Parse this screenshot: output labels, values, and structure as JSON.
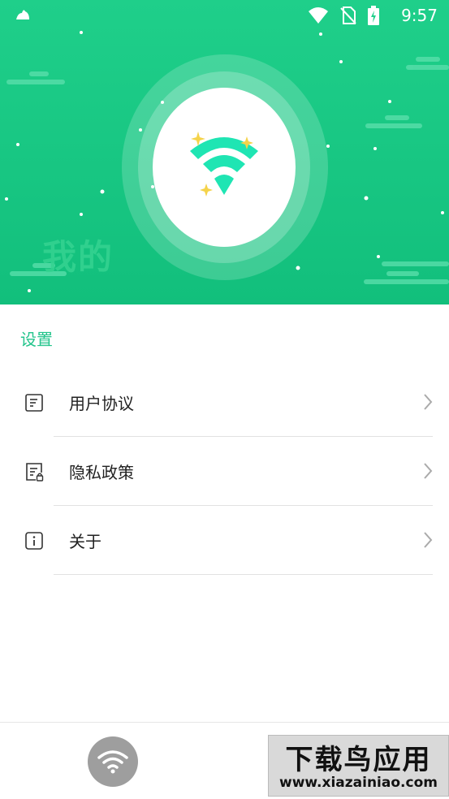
{
  "status_bar": {
    "time": "9:57",
    "icons": [
      "notification-icon",
      "wifi-signal-icon",
      "no-sim-icon",
      "battery-charging-icon"
    ]
  },
  "hero": {
    "title": "我的",
    "logo_icon": "wifi-sparkle-icon"
  },
  "settings": {
    "section_title": "设置",
    "items": [
      {
        "label": "用户协议",
        "icon": "document-icon"
      },
      {
        "label": "隐私政策",
        "icon": "privacy-document-icon"
      },
      {
        "label": "关于",
        "icon": "info-icon"
      }
    ]
  },
  "bottom_nav": {
    "items": [
      "wifi-icon",
      "mine-icon"
    ]
  },
  "watermark": {
    "top": "下载鸟应用",
    "bottom": "www.xiazainiao.com"
  },
  "colors": {
    "accent": "#22c48b",
    "hero": "#1fcf8a",
    "nav_gray": "#9e9e9e"
  }
}
